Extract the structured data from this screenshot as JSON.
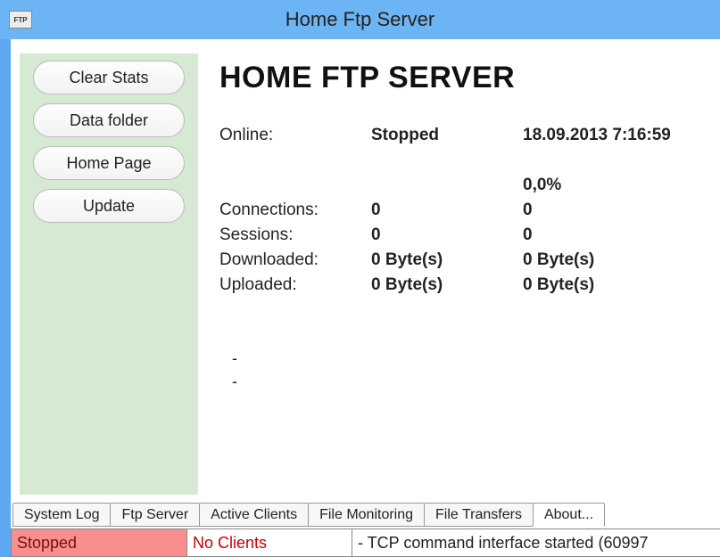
{
  "window": {
    "icon_label": "FTP",
    "title": "Home Ftp Server"
  },
  "sidebar": {
    "buttons": {
      "clear_stats": "Clear Stats",
      "data_folder": "Data folder",
      "home_page": "Home Page",
      "update": "Update"
    }
  },
  "content": {
    "heading": "HOME FTP SERVER",
    "rows": {
      "online": {
        "label": "Online:",
        "status": "Stopped",
        "datetime": "18.09.2013 7:16:59"
      },
      "percent": {
        "value": "0,0%"
      },
      "connections": {
        "label": "Connections:",
        "val1": "0",
        "val2": "0"
      },
      "sessions": {
        "label": "Sessions:",
        "val1": "0",
        "val2": "0"
      },
      "downloaded": {
        "label": "Downloaded:",
        "val1": "0 Byte(s)",
        "val2": "0 Byte(s)"
      },
      "uploaded": {
        "label": "Uploaded:",
        "val1": "0 Byte(s)",
        "val2": "0 Byte(s)"
      }
    },
    "dash1": "-",
    "dash2": "-"
  },
  "tabs": {
    "system_log": "System Log",
    "ftp_server": "Ftp Server",
    "active_clients": "Active Clients",
    "file_monitoring": "File Monitoring",
    "file_transfers": "File Transfers",
    "about": "About..."
  },
  "statusbar": {
    "status": "Stopped",
    "clients": "No Clients",
    "log": "- TCP command interface started (60997"
  }
}
